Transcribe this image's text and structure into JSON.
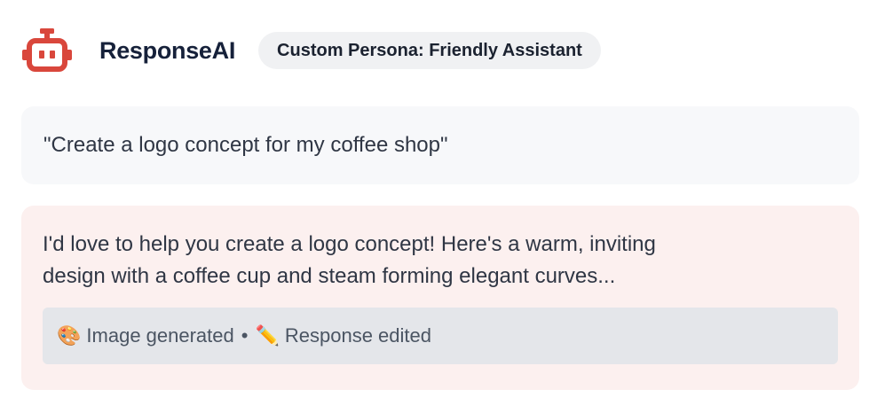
{
  "app": {
    "title": "ResponseAI",
    "logo_icon": "robot-icon",
    "accent_color": "#d9473c"
  },
  "persona": {
    "label": "Custom Persona: Friendly Assistant"
  },
  "conversation": {
    "user_message": "\"Create a logo concept for my coffee shop\"",
    "ai_response": {
      "text_line_1": "I'd love to help you create a logo concept! Here's a warm, inviting",
      "text_line_2": "design with a coffee cup and steam forming elegant curves...",
      "status": {
        "image_icon": "🎨",
        "image_label": "Image generated",
        "separator": "•",
        "edit_icon": "✏️",
        "edit_label": "Response edited"
      }
    }
  }
}
